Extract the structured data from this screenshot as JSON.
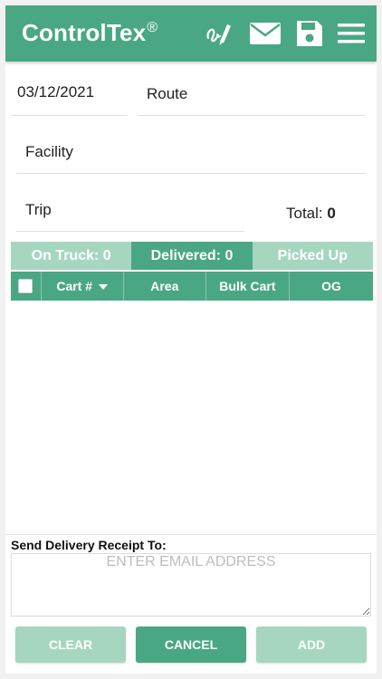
{
  "header": {
    "brand": "ControlTex",
    "brand_mark": "®",
    "icons": [
      "signature-icon",
      "mail-icon",
      "save-icon",
      "menu-icon"
    ]
  },
  "form": {
    "date": "03/12/2021",
    "route_label": "Route",
    "facility_label": "Facility",
    "trip_label": "Trip",
    "total_label": "Total:",
    "total_value": "0"
  },
  "tabs": [
    {
      "label": "On Truck: 0"
    },
    {
      "label": "Delivered: 0"
    },
    {
      "label": "Picked Up"
    }
  ],
  "table": {
    "columns": [
      "Cart #",
      "Area",
      "Bulk Cart",
      "OG"
    ],
    "rows": []
  },
  "receipt": {
    "label": "Send Delivery Receipt To:",
    "email_placeholder": "ENTER EMAIL ADDRESS",
    "email_value": ""
  },
  "buttons": {
    "clear": "CLEAR",
    "cancel": "CANCEL",
    "add": "ADD"
  },
  "colors": {
    "primary": "#4aa784",
    "primary_light": "#a6d6c0"
  }
}
